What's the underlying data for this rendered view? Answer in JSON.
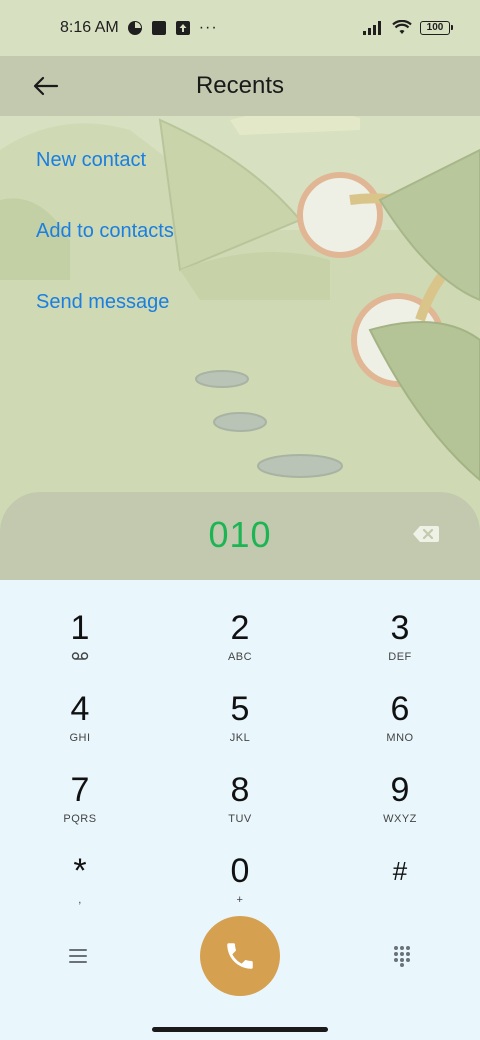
{
  "status_bar": {
    "time": "8:16 AM",
    "battery": "100",
    "more_indicator": "···"
  },
  "header": {
    "title": "Recents"
  },
  "actions": {
    "new_contact": "New contact",
    "add_to_contacts": "Add to contacts",
    "send_message": "Send message"
  },
  "dialer": {
    "number": "010"
  },
  "keys": [
    {
      "digit": "1",
      "letters": ""
    },
    {
      "digit": "2",
      "letters": "ABC"
    },
    {
      "digit": "3",
      "letters": "DEF"
    },
    {
      "digit": "4",
      "letters": "GHI"
    },
    {
      "digit": "5",
      "letters": "JKL"
    },
    {
      "digit": "6",
      "letters": "MNO"
    },
    {
      "digit": "7",
      "letters": "PQRS"
    },
    {
      "digit": "8",
      "letters": "TUV"
    },
    {
      "digit": "9",
      "letters": "WXYZ"
    },
    {
      "digit": "*",
      "letters": ","
    },
    {
      "digit": "0",
      "letters": "+"
    },
    {
      "digit": "#",
      "letters": ""
    }
  ],
  "icons": {
    "back": "back-arrow-icon",
    "backspace": "backspace-icon",
    "voicemail": "voicemail-icon",
    "menu": "menu-icon",
    "call": "phone-icon",
    "dialpad": "dialpad-icon"
  },
  "colors": {
    "accent_link": "#1a7fe0",
    "dialed_number": "#1db454",
    "call_button": "#d5a150",
    "panel": "#c2c9ae",
    "keypad_bg": "#e9f6fc"
  }
}
